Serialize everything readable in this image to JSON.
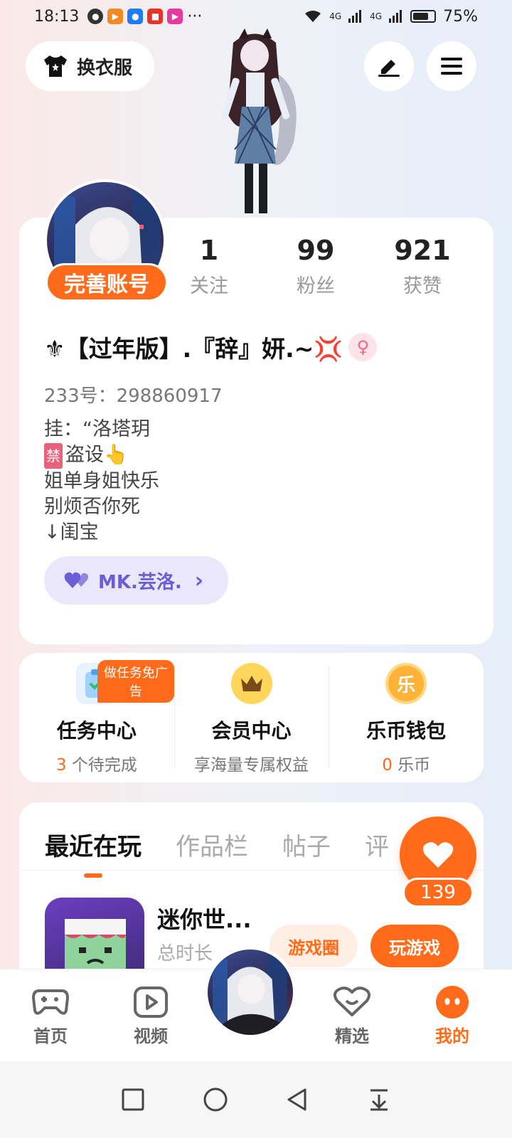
{
  "status_bar": {
    "time": "18:13",
    "dots": "···",
    "network_1": "4G",
    "network_2": "4G",
    "battery_level": 0.75,
    "battery_text": "75%"
  },
  "header": {
    "outfit_label": "换衣服"
  },
  "profile": {
    "complete_label": "完善账号",
    "stats": [
      {
        "value": "1",
        "label": "关注"
      },
      {
        "value": "99",
        "label": "粉丝"
      },
      {
        "value": "921",
        "label": "获赞"
      }
    ],
    "nickname": "⚜【过年版】.『辞』妍.~💢",
    "id_text": "233号：298860917",
    "bio": {
      "line1": "挂：“洛塔玥",
      "ban_chip": "禁",
      "line2": "盗设👆",
      "line3": "姐单身姐快乐",
      "line4": "别烦否你死",
      "line5": "↓闺宝"
    },
    "bond_label": "MK.芸洛.",
    "bond_arrow": "›"
  },
  "center": {
    "ad_badge": "做任务免广告",
    "items": [
      {
        "title": "任务中心",
        "count": "3",
        "sub": "个待完成"
      },
      {
        "title": "会员中心",
        "sub": "享海量专属权益"
      },
      {
        "title": "乐币钱包",
        "count": "0",
        "sub": "乐币",
        "icon_text": "乐"
      }
    ]
  },
  "tabs": [
    "最近在玩",
    "作品栏",
    "帖子",
    "评"
  ],
  "recent_game": {
    "name": "迷你世...",
    "time_label": "总时长",
    "circle_label": "游戏圈",
    "play_label": "玩游戏"
  },
  "like": {
    "count": "139"
  },
  "bottom_nav": [
    {
      "label": "首页"
    },
    {
      "label": "视频"
    },
    {
      "label": "精选"
    },
    {
      "label": "我的"
    }
  ],
  "colors": {
    "accent": "#ff6b1a",
    "bond": "#6a5dd6"
  }
}
